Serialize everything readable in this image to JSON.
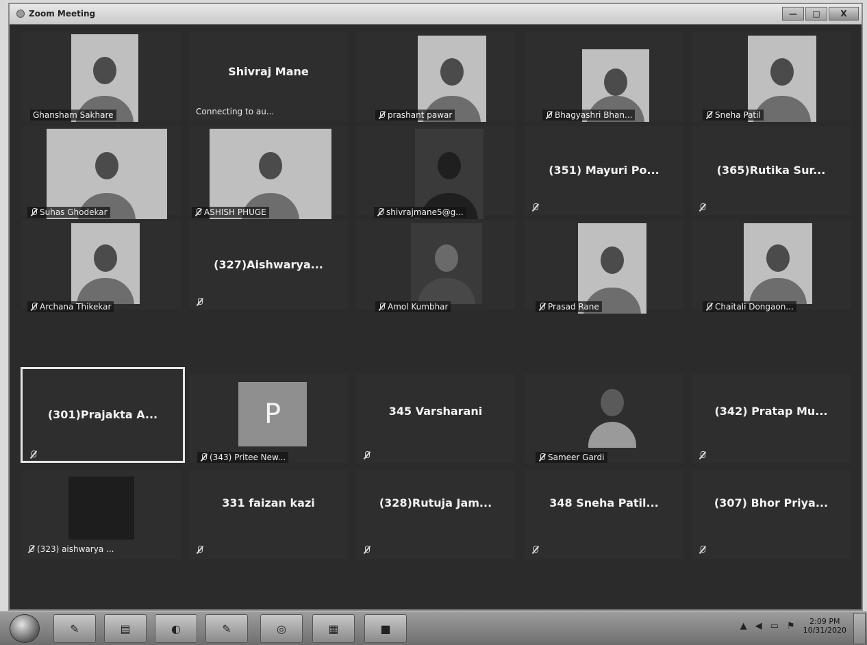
{
  "window": {
    "title": "Zoom Meeting",
    "minimize": "—",
    "maximize": "□",
    "close": "X"
  },
  "participants": [
    {
      "name": "Ghansham Sakhare",
      "muted": false
    },
    {
      "name": "Shivraj Mane",
      "status": "Connecting to au..."
    },
    {
      "name": "prashant pawar",
      "muted": true
    },
    {
      "name": "Bhagyashri Bhan...",
      "muted": true
    },
    {
      "name": "Sneha Patil",
      "muted": true
    },
    {
      "name": "Suhas Ghodekar",
      "muted": true
    },
    {
      "name": "ASHISH PHUGE",
      "muted": true
    },
    {
      "name": "shivrajmane5@g...",
      "muted": true
    },
    {
      "name": "(351) Mayuri Po...",
      "muted": true
    },
    {
      "name": "(365)Rutika Sur...",
      "muted": true
    },
    {
      "name": "Archana Thikekar",
      "muted": true
    },
    {
      "name": "(327)Aishwarya...",
      "muted": true
    },
    {
      "name": "Amol Kumbhar",
      "muted": true
    },
    {
      "name": "Prasad Rane",
      "muted": true
    },
    {
      "name": "Chaitali Dongaon...",
      "muted": true
    },
    {
      "name": "(301)Prajakta A...",
      "muted": true,
      "active_speaker": true
    },
    {
      "name": "(343) Pritee New...",
      "muted": true,
      "avatar_letter": "P"
    },
    {
      "name": "345 Varsharani",
      "muted": true
    },
    {
      "name": "Sameer Gardi",
      "muted": true
    },
    {
      "name": "(342) Pratap Mu...",
      "muted": true
    },
    {
      "name": "(323) aishwarya ...",
      "muted": true
    },
    {
      "name": "331 faizan kazi",
      "muted": true
    },
    {
      "name": "(328)Rutuja Jam...",
      "muted": true
    },
    {
      "name": "348 Sneha Patil...",
      "muted": true
    },
    {
      "name": "(307) Bhor Priya...",
      "muted": true
    }
  ],
  "taskbar": {
    "items": [
      "start-orb",
      "pencil-icon",
      "folder-icon",
      "media-player-icon",
      "paint-icon",
      "chrome-icon",
      "excel-icon",
      "zoom-icon"
    ],
    "glyphs": {
      "folder": "▤",
      "media": "◐",
      "paint": "✎",
      "chrome": "◎",
      "excel": "▦",
      "zoom": "■"
    },
    "tray_arrow": "▲",
    "time": "2:09 PM",
    "date": "10/31/2020"
  }
}
